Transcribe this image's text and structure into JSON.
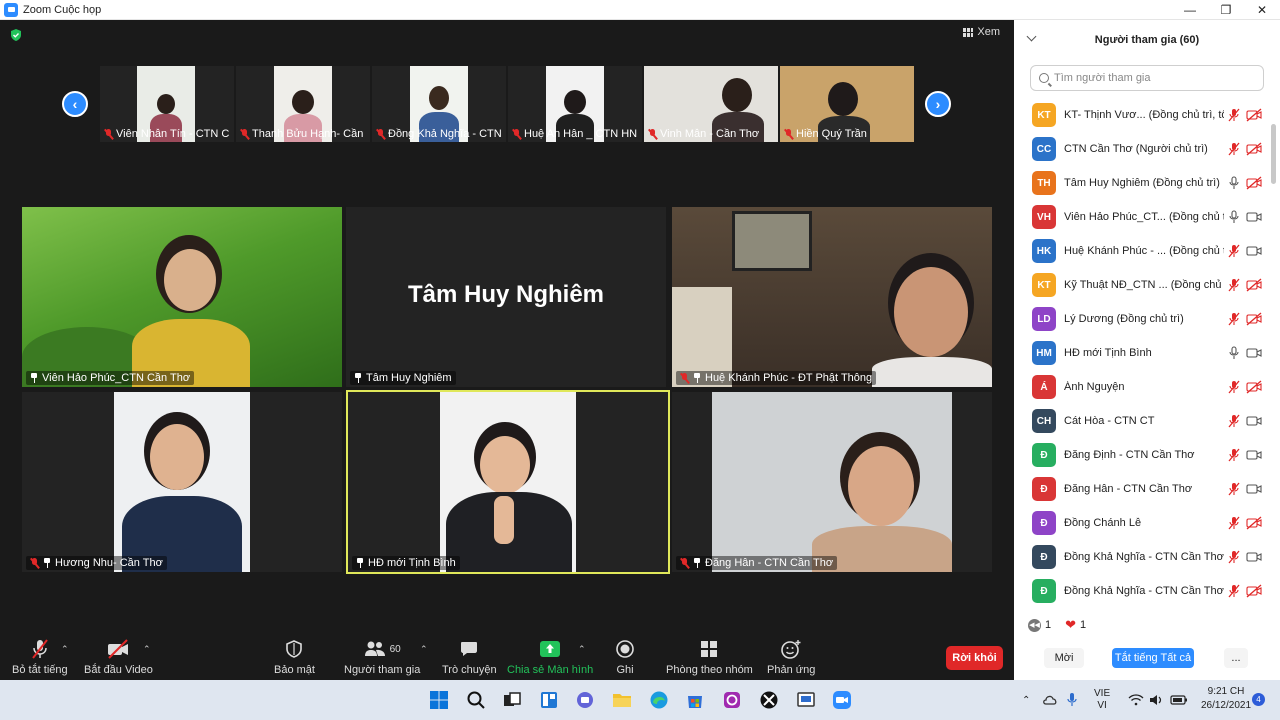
{
  "window": {
    "title": "Zoom Cuộc họp"
  },
  "meeting": {
    "view_label": "Xem",
    "thumbnails": [
      {
        "name": "Viên Nhẫn Tín - CTN C..."
      },
      {
        "name": "Thanh Bửu Hạnh- Cần ..."
      },
      {
        "name": "Đồng Khả Nghĩa - CTN..."
      },
      {
        "name": "Huệ An Hân _ CTN HN"
      },
      {
        "name": "Vinh Mẫn - Cần Thơ"
      },
      {
        "name": "Hiền Quý Trần"
      }
    ],
    "tiles": [
      {
        "name": "Viên Hảo Phúc_CTN Cần Thơ"
      },
      {
        "name": "Tâm Huy Nghiêm",
        "display_name": "Tâm Huy Nghiêm"
      },
      {
        "name": "Huệ Khánh Phúc - ĐT Phật Thông"
      },
      {
        "name": "Hương Nhu- Cần Thơ"
      },
      {
        "name": "HĐ mới Tịnh Bình"
      },
      {
        "name": "Đăng Hân - CTN Cần Thơ"
      }
    ]
  },
  "toolbar": {
    "mute_label": "Bỏ tắt tiếng",
    "video_label": "Bắt đầu Video",
    "security_label": "Bảo mật",
    "participants_label": "Người tham gia",
    "participants_count": "60",
    "chat_label": "Trò chuyện",
    "share_label": "Chia sẻ Màn hình",
    "record_label": "Ghi",
    "breakout_label": "Phòng theo nhóm",
    "reactions_label": "Phản ứng",
    "leave_label": "Rời khỏi"
  },
  "panel": {
    "title": "Người tham gia (60)",
    "search_placeholder": "Tìm người tham gia",
    "participants": [
      {
        "initials": "KT",
        "color": "#f5a623",
        "name": "KT- Thịnh Vươ... (Đồng chủ trì, tôi)",
        "mic": "muted",
        "video": "off"
      },
      {
        "initials": "CC",
        "color": "#2b73c9",
        "name": "CTN Cần Thơ (Người chủ trì)",
        "mic": "muted",
        "video": "off"
      },
      {
        "initials": "TH",
        "color": "#e8731c",
        "name": "Tâm Huy Nghiêm (Đồng chủ trì)",
        "mic": "on",
        "video": "off"
      },
      {
        "initials": "VH",
        "color": "#d93636",
        "name": "Viên Hảo Phúc_CT... (Đồng chủ trì)",
        "mic": "on",
        "video": "on"
      },
      {
        "initials": "HK",
        "color": "#2b73c9",
        "name": "Huệ Khánh Phúc - ... (Đồng chủ trì)",
        "mic": "muted",
        "video": "on"
      },
      {
        "initials": "KT",
        "color": "#f5a623",
        "name": "Kỹ Thuật NĐ_CTN ... (Đồng chủ trì)",
        "mic": "muted",
        "video": "off"
      },
      {
        "initials": "LD",
        "color": "#8e44c7",
        "name": "Lý Dương (Đồng chủ trì)",
        "mic": "muted",
        "video": "off"
      },
      {
        "initials": "HM",
        "color": "#2b73c9",
        "name": "HĐ mới Tịnh Bình",
        "mic": "on",
        "video": "on"
      },
      {
        "initials": "Á",
        "color": "#d93636",
        "name": "Ánh Nguyện",
        "mic": "muted",
        "video": "off"
      },
      {
        "initials": "CH",
        "color": "#34495e",
        "name": "Cát Hòa - CTN CT",
        "mic": "muted",
        "video": "on"
      },
      {
        "initials": "Đ",
        "color": "#27ae60",
        "name": "Đăng Định - CTN Cần Thơ",
        "mic": "muted",
        "video": "on"
      },
      {
        "initials": "Đ",
        "color": "#d93636",
        "name": "Đăng Hân - CTN Cần Thơ",
        "mic": "muted",
        "video": "on"
      },
      {
        "initials": "Đ",
        "color": "#8e44c7",
        "name": "Đồng Chánh Lễ",
        "mic": "muted",
        "video": "off"
      },
      {
        "initials": "Đ",
        "color": "#34495e",
        "name": "Đồng Khả Nghĩa - CTN Cần Thơ",
        "mic": "muted",
        "video": "on"
      },
      {
        "initials": "Đ",
        "color": "#27ae60",
        "name": "Đồng Khả Nghĩa - CTN Cần Thơ (...",
        "mic": "muted",
        "video": "off"
      }
    ],
    "reactions": {
      "rewind_count": "1",
      "heart_count": "1"
    },
    "invite_label": "Mời",
    "mute_all_label": "Tắt tiếng Tất cả",
    "more_label": "..."
  },
  "taskbar": {
    "lang_top": "VIE",
    "lang_bottom": "VI",
    "time": "9:21 CH",
    "date": "26/12/2021",
    "notif_count": "4"
  }
}
